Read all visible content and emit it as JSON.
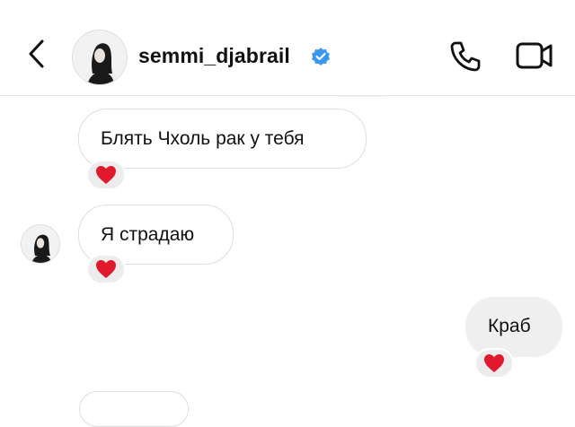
{
  "header": {
    "username": "semmi_djabrail",
    "verified": true
  },
  "messages": [
    {
      "direction": "incoming",
      "text": "Блять Чхоль рак у тебя",
      "reaction": "heart"
    },
    {
      "direction": "incoming",
      "text": "Я страдаю",
      "reaction": "heart"
    },
    {
      "direction": "outgoing",
      "text": "Краб",
      "reaction": "heart"
    }
  ],
  "colors": {
    "verified_badge": "#3897f0",
    "heart": "#e0192d",
    "outgoing_bubble": "#efefef",
    "incoming_border": "#dedede"
  }
}
